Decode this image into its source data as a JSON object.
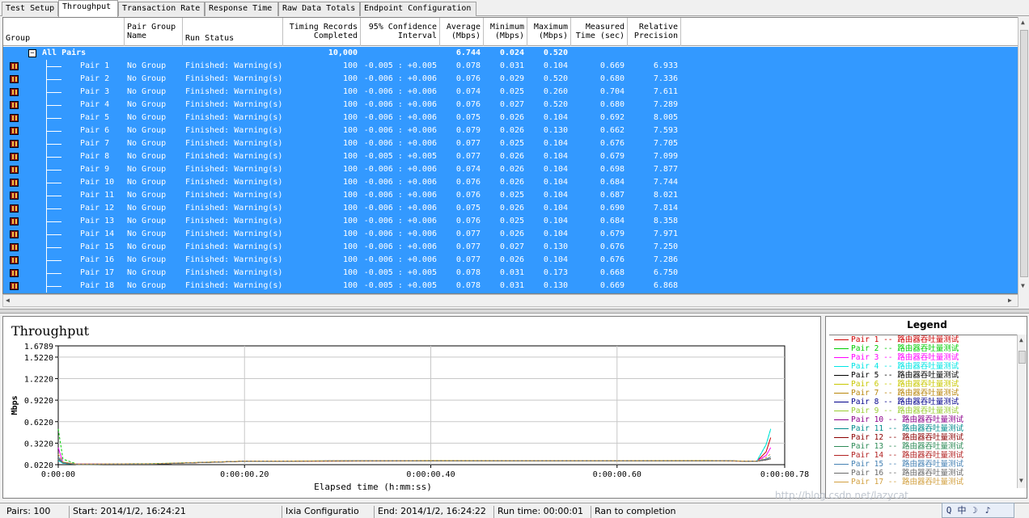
{
  "tabs": [
    "Test Setup",
    "Throughput",
    "Transaction Rate",
    "Response Time",
    "Raw Data Totals",
    "Endpoint Configuration"
  ],
  "columns": {
    "group": "Group",
    "pair_group_name": [
      "Pair Group",
      "Name"
    ],
    "run_status": "Run Status",
    "timing_records": [
      "Timing Records",
      "Completed"
    ],
    "confidence": [
      "95% Confidence",
      "Interval"
    ],
    "average": [
      "Average",
      "(Mbps)"
    ],
    "minimum": [
      "Minimum",
      "(Mbps)"
    ],
    "maximum": [
      "Maximum",
      "(Mbps)"
    ],
    "measured_time": [
      "Measured",
      "Time (sec)"
    ],
    "relative_precision": [
      "Relative",
      "Precision"
    ]
  },
  "all_pairs": {
    "label": "All Pairs",
    "records": "10,000",
    "average": "6.744",
    "minimum": "0.024",
    "maximum": "0.520"
  },
  "rows": [
    {
      "pair": "Pair 1",
      "group": "No Group",
      "status": "Finished: Warning(s)",
      "records": "100",
      "ci": "-0.005 : +0.005",
      "avg": "0.078",
      "min": "0.031",
      "max": "0.104",
      "time": "0.669",
      "prec": "6.933"
    },
    {
      "pair": "Pair 2",
      "group": "No Group",
      "status": "Finished: Warning(s)",
      "records": "100",
      "ci": "-0.006 : +0.006",
      "avg": "0.076",
      "min": "0.029",
      "max": "0.520",
      "time": "0.680",
      "prec": "7.336"
    },
    {
      "pair": "Pair 3",
      "group": "No Group",
      "status": "Finished: Warning(s)",
      "records": "100",
      "ci": "-0.006 : +0.006",
      "avg": "0.074",
      "min": "0.025",
      "max": "0.260",
      "time": "0.704",
      "prec": "7.611"
    },
    {
      "pair": "Pair 4",
      "group": "No Group",
      "status": "Finished: Warning(s)",
      "records": "100",
      "ci": "-0.006 : +0.006",
      "avg": "0.076",
      "min": "0.027",
      "max": "0.520",
      "time": "0.680",
      "prec": "7.289"
    },
    {
      "pair": "Pair 5",
      "group": "No Group",
      "status": "Finished: Warning(s)",
      "records": "100",
      "ci": "-0.006 : +0.006",
      "avg": "0.075",
      "min": "0.026",
      "max": "0.104",
      "time": "0.692",
      "prec": "8.005"
    },
    {
      "pair": "Pair 6",
      "group": "No Group",
      "status": "Finished: Warning(s)",
      "records": "100",
      "ci": "-0.006 : +0.006",
      "avg": "0.079",
      "min": "0.026",
      "max": "0.130",
      "time": "0.662",
      "prec": "7.593"
    },
    {
      "pair": "Pair 7",
      "group": "No Group",
      "status": "Finished: Warning(s)",
      "records": "100",
      "ci": "-0.006 : +0.006",
      "avg": "0.077",
      "min": "0.025",
      "max": "0.104",
      "time": "0.676",
      "prec": "7.705"
    },
    {
      "pair": "Pair 8",
      "group": "No Group",
      "status": "Finished: Warning(s)",
      "records": "100",
      "ci": "-0.005 : +0.005",
      "avg": "0.077",
      "min": "0.026",
      "max": "0.104",
      "time": "0.679",
      "prec": "7.099"
    },
    {
      "pair": "Pair 9",
      "group": "No Group",
      "status": "Finished: Warning(s)",
      "records": "100",
      "ci": "-0.006 : +0.006",
      "avg": "0.074",
      "min": "0.026",
      "max": "0.104",
      "time": "0.698",
      "prec": "7.877"
    },
    {
      "pair": "Pair 10",
      "group": "No Group",
      "status": "Finished: Warning(s)",
      "records": "100",
      "ci": "-0.006 : +0.006",
      "avg": "0.076",
      "min": "0.026",
      "max": "0.104",
      "time": "0.684",
      "prec": "7.744"
    },
    {
      "pair": "Pair 11",
      "group": "No Group",
      "status": "Finished: Warning(s)",
      "records": "100",
      "ci": "-0.006 : +0.006",
      "avg": "0.076",
      "min": "0.025",
      "max": "0.104",
      "time": "0.687",
      "prec": "8.021"
    },
    {
      "pair": "Pair 12",
      "group": "No Group",
      "status": "Finished: Warning(s)",
      "records": "100",
      "ci": "-0.006 : +0.006",
      "avg": "0.075",
      "min": "0.026",
      "max": "0.104",
      "time": "0.690",
      "prec": "7.814"
    },
    {
      "pair": "Pair 13",
      "group": "No Group",
      "status": "Finished: Warning(s)",
      "records": "100",
      "ci": "-0.006 : +0.006",
      "avg": "0.076",
      "min": "0.025",
      "max": "0.104",
      "time": "0.684",
      "prec": "8.358"
    },
    {
      "pair": "Pair 14",
      "group": "No Group",
      "status": "Finished: Warning(s)",
      "records": "100",
      "ci": "-0.006 : +0.006",
      "avg": "0.077",
      "min": "0.026",
      "max": "0.104",
      "time": "0.679",
      "prec": "7.971"
    },
    {
      "pair": "Pair 15",
      "group": "No Group",
      "status": "Finished: Warning(s)",
      "records": "100",
      "ci": "-0.006 : +0.006",
      "avg": "0.077",
      "min": "0.027",
      "max": "0.130",
      "time": "0.676",
      "prec": "7.250"
    },
    {
      "pair": "Pair 16",
      "group": "No Group",
      "status": "Finished: Warning(s)",
      "records": "100",
      "ci": "-0.006 : +0.006",
      "avg": "0.077",
      "min": "0.026",
      "max": "0.104",
      "time": "0.676",
      "prec": "7.286"
    },
    {
      "pair": "Pair 17",
      "group": "No Group",
      "status": "Finished: Warning(s)",
      "records": "100",
      "ci": "-0.005 : +0.005",
      "avg": "0.078",
      "min": "0.031",
      "max": "0.173",
      "time": "0.668",
      "prec": "6.750"
    },
    {
      "pair": "Pair 18",
      "group": "No Group",
      "status": "Finished: Warning(s)",
      "records": "100",
      "ci": "-0.005 : +0.005",
      "avg": "0.078",
      "min": "0.031",
      "max": "0.130",
      "time": "0.669",
      "prec": "6.868"
    }
  ],
  "chart_data": {
    "type": "line",
    "title": "Throughput",
    "xlabel": "Elapsed time (h:mm:ss)",
    "ylabel": "Mbps",
    "y_ticks": [
      0.022,
      0.322,
      0.622,
      0.922,
      1.222,
      1.522,
      1.6789
    ],
    "y_tick_labels": [
      "0.0220",
      "0.3220",
      "0.6220",
      "0.9220",
      "1.2220",
      "1.5220",
      "1.6789"
    ],
    "ylim": [
      0.022,
      1.6789
    ],
    "x_ticks": [
      0,
      0.2,
      0.4,
      0.6,
      0.78
    ],
    "x_tick_labels": [
      "0:00:00",
      "0:00:00.20",
      "0:00:00.40",
      "0:00:00.60",
      "0:00:00.78"
    ],
    "xlim": [
      0,
      0.78
    ],
    "grid": true,
    "series": [
      {
        "name": "Pair 1",
        "x": [
          0,
          0.005,
          0.02,
          0.1,
          0.2,
          0.4,
          0.6,
          0.7,
          0.75,
          0.76,
          0.765
        ],
        "y": [
          0.1,
          0.04,
          0.03,
          0.03,
          0.07,
          0.075,
          0.078,
          0.075,
          0.07,
          0.2,
          0.4
        ]
      },
      {
        "name": "Pair 2",
        "x": [
          0,
          0.005,
          0.02,
          0.1,
          0.2,
          0.4,
          0.6,
          0.7,
          0.75,
          0.76,
          0.765
        ],
        "y": [
          0.52,
          0.1,
          0.03,
          0.035,
          0.07,
          0.076,
          0.075,
          0.076,
          0.07,
          0.3,
          0.52
        ]
      },
      {
        "name": "Pair 3",
        "x": [
          0,
          0.005,
          0.02,
          0.1,
          0.2,
          0.4,
          0.6,
          0.7,
          0.75,
          0.76,
          0.765
        ],
        "y": [
          0.26,
          0.05,
          0.03,
          0.03,
          0.068,
          0.074,
          0.073,
          0.074,
          0.07,
          0.15,
          0.26
        ]
      },
      {
        "name": "Pair 4",
        "x": [
          0,
          0.005,
          0.02,
          0.1,
          0.2,
          0.4,
          0.6,
          0.7,
          0.75,
          0.76,
          0.765
        ],
        "y": [
          0.08,
          0.04,
          0.027,
          0.03,
          0.07,
          0.076,
          0.076,
          0.076,
          0.07,
          0.3,
          0.52
        ]
      },
      {
        "name": "Pair 5",
        "x": [
          0,
          0.005,
          0.02,
          0.1,
          0.2,
          0.4,
          0.6,
          0.7,
          0.75,
          0.76,
          0.765
        ],
        "y": [
          0.1,
          0.05,
          0.026,
          0.03,
          0.07,
          0.075,
          0.075,
          0.075,
          0.07,
          0.09,
          0.104
        ]
      },
      {
        "name": "Pair 6",
        "x": [
          0,
          0.005,
          0.02,
          0.1,
          0.2,
          0.4,
          0.6,
          0.7,
          0.75,
          0.76,
          0.765
        ],
        "y": [
          0.13,
          0.05,
          0.026,
          0.03,
          0.072,
          0.079,
          0.078,
          0.079,
          0.07,
          0.1,
          0.13
        ]
      },
      {
        "name": "Pair 7",
        "x": [
          0,
          0.005,
          0.02,
          0.1,
          0.2,
          0.4,
          0.6,
          0.7,
          0.75,
          0.76,
          0.765
        ],
        "y": [
          0.1,
          0.05,
          0.025,
          0.03,
          0.07,
          0.077,
          0.077,
          0.077,
          0.07,
          0.09,
          0.104
        ]
      },
      {
        "name": "Pair 8",
        "x": [
          0,
          0.005,
          0.02,
          0.1,
          0.2,
          0.4,
          0.6,
          0.7,
          0.75,
          0.76,
          0.765
        ],
        "y": [
          0.1,
          0.05,
          0.026,
          0.03,
          0.07,
          0.077,
          0.077,
          0.077,
          0.07,
          0.09,
          0.104
        ]
      },
      {
        "name": "Pair 9",
        "x": [
          0,
          0.005,
          0.02,
          0.1,
          0.2,
          0.4,
          0.6,
          0.7,
          0.75,
          0.76,
          0.765
        ],
        "y": [
          0.1,
          0.05,
          0.026,
          0.03,
          0.068,
          0.074,
          0.074,
          0.074,
          0.07,
          0.09,
          0.104
        ]
      },
      {
        "name": "Pair 10",
        "x": [
          0,
          0.005,
          0.02,
          0.1,
          0.2,
          0.4,
          0.6,
          0.7,
          0.75,
          0.76,
          0.765
        ],
        "y": [
          0.1,
          0.05,
          0.026,
          0.03,
          0.07,
          0.076,
          0.076,
          0.076,
          0.07,
          0.09,
          0.104
        ]
      },
      {
        "name": "Pair 11",
        "x": [
          0,
          0.005,
          0.02,
          0.1,
          0.2,
          0.4,
          0.6,
          0.7,
          0.75,
          0.76,
          0.765
        ],
        "y": [
          0.1,
          0.05,
          0.025,
          0.03,
          0.07,
          0.076,
          0.076,
          0.076,
          0.07,
          0.09,
          0.104
        ]
      },
      {
        "name": "Pair 12",
        "x": [
          0,
          0.005,
          0.02,
          0.1,
          0.2,
          0.4,
          0.6,
          0.7,
          0.75,
          0.76,
          0.765
        ],
        "y": [
          0.1,
          0.05,
          0.026,
          0.03,
          0.069,
          0.075,
          0.075,
          0.075,
          0.07,
          0.09,
          0.104
        ]
      },
      {
        "name": "Pair 13",
        "x": [
          0,
          0.005,
          0.02,
          0.1,
          0.2,
          0.4,
          0.6,
          0.7,
          0.75,
          0.76,
          0.765
        ],
        "y": [
          0.1,
          0.05,
          0.025,
          0.03,
          0.07,
          0.076,
          0.076,
          0.076,
          0.07,
          0.09,
          0.104
        ]
      },
      {
        "name": "Pair 14",
        "x": [
          0,
          0.005,
          0.02,
          0.1,
          0.2,
          0.4,
          0.6,
          0.7,
          0.75,
          0.76,
          0.765
        ],
        "y": [
          0.1,
          0.05,
          0.026,
          0.03,
          0.071,
          0.077,
          0.077,
          0.077,
          0.07,
          0.09,
          0.104
        ]
      },
      {
        "name": "Pair 15",
        "x": [
          0,
          0.005,
          0.02,
          0.1,
          0.2,
          0.4,
          0.6,
          0.7,
          0.75,
          0.76,
          0.765
        ],
        "y": [
          0.13,
          0.05,
          0.027,
          0.03,
          0.071,
          0.077,
          0.077,
          0.077,
          0.07,
          0.1,
          0.13
        ]
      },
      {
        "name": "Pair 16",
        "x": [
          0,
          0.005,
          0.02,
          0.1,
          0.2,
          0.4,
          0.6,
          0.7,
          0.75,
          0.76,
          0.765
        ],
        "y": [
          0.1,
          0.05,
          0.026,
          0.03,
          0.071,
          0.077,
          0.077,
          0.077,
          0.07,
          0.09,
          0.104
        ]
      },
      {
        "name": "Pair 17",
        "x": [
          0,
          0.005,
          0.02,
          0.1,
          0.2,
          0.4,
          0.6,
          0.7,
          0.75,
          0.76,
          0.765
        ],
        "y": [
          0.17,
          0.06,
          0.031,
          0.035,
          0.072,
          0.078,
          0.078,
          0.078,
          0.07,
          0.12,
          0.173
        ]
      }
    ]
  },
  "legend": {
    "title": "Legend",
    "separator": "--",
    "label": "路由器吞吐量测试",
    "items": [
      {
        "name": "Pair 1",
        "color": "#cc0000"
      },
      {
        "name": "Pair 2",
        "color": "#00cc00"
      },
      {
        "name": "Pair 3",
        "color": "#ff00ff"
      },
      {
        "name": "Pair 4",
        "color": "#00e5e5"
      },
      {
        "name": "Pair 5",
        "color": "#000000"
      },
      {
        "name": "Pair 6",
        "color": "#c8c800"
      },
      {
        "name": "Pair 7",
        "color": "#b8860b"
      },
      {
        "name": "Pair 8",
        "color": "#00008b"
      },
      {
        "name": "Pair 9",
        "color": "#9acd32"
      },
      {
        "name": "Pair 10",
        "color": "#8b008b"
      },
      {
        "name": "Pair 11",
        "color": "#008b8b"
      },
      {
        "name": "Pair 12",
        "color": "#8b0000"
      },
      {
        "name": "Pair 13",
        "color": "#2e8b57"
      },
      {
        "name": "Pair 14",
        "color": "#b22222"
      },
      {
        "name": "Pair 15",
        "color": "#4682b4"
      },
      {
        "name": "Pair 16",
        "color": "#696969"
      },
      {
        "name": "Pair 17",
        "color": "#d2a040"
      }
    ]
  },
  "status": {
    "pairs": "Pairs: 100",
    "start": "Start: 2014/1/2, 16:24:21",
    "config": "Ixia Configuratio",
    "end": "End: 2014/1/2, 16:24:22",
    "run_time": "Run time: 00:00:01",
    "completion": "Ran to completion"
  },
  "watermark": "http://blog.csdn.net/lazycat",
  "tray": [
    "Q",
    "中",
    "☽",
    "♪"
  ]
}
